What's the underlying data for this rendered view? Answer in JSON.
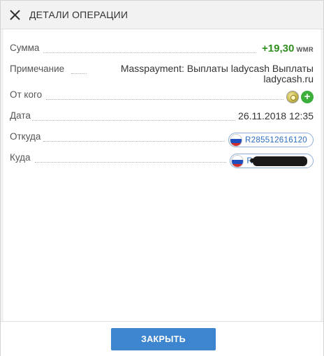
{
  "dialog": {
    "title": "ДЕТАЛИ ОПЕРАЦИИ",
    "close_icon": "close-x-icon"
  },
  "details": {
    "amount": {
      "label": "Сумма",
      "value": "+19,30",
      "unit": "WMR",
      "color": "#2f8f1f"
    },
    "note": {
      "label": "Примечание",
      "value": "Masspayment: Выплаты ladycash Выплаты ladycash.ru"
    },
    "from": {
      "label": "От кого",
      "icons": [
        "coin-icon",
        "add-contact-plus-icon"
      ]
    },
    "date": {
      "label": "Дата",
      "value": "26.11.2018 12:35"
    },
    "source": {
      "label": "Откуда",
      "purse": "R285512616120",
      "flag": "russia-flag-icon"
    },
    "destination": {
      "label": "Куда",
      "purse_prefix": "R",
      "flag": "russia-flag-icon",
      "redacted": true
    }
  },
  "footer": {
    "close_label": "ЗАКРЫТЬ",
    "button_color": "#3d86cf"
  }
}
